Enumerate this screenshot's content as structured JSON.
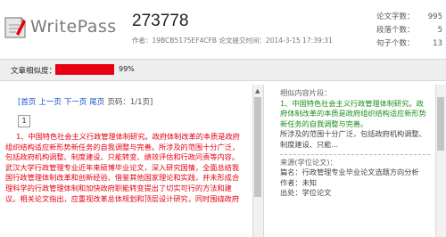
{
  "header": {
    "logo_text": "WritePass",
    "doc_id": "273778",
    "meta": "作者：19BCB5175EF4CFB  论文提交时间：2014-3-15 17:39:31"
  },
  "stats": [
    {
      "label": "论文字数：",
      "value": "995"
    },
    {
      "label": "段落个数：",
      "value": "5"
    },
    {
      "label": "句子个数：",
      "value": "13"
    }
  ],
  "similarity": {
    "label": "文章相似度：",
    "value": 0.99,
    "percent_text": "99%",
    "bar_color": "#e60012"
  },
  "nav": {
    "first": "[首页",
    "prev": "上一页",
    "next": "下一页",
    "last": "尾页",
    "page_info": "页码：1/1页]"
  },
  "page_number": "1",
  "content": "1、中国特色社会主义行政管理体制研究。政府体制改革的本质是政府组织结构适应新形势新任务的自我调整与完善。所涉及的范围十分广泛，包括政府机构调整、制度建设、只能转变、绩效评估和行政问责等内容。武汉大学行政管理专业近年来硕博毕业论文，深入研究国情，全面总结我国行政管理体制改革和创新经验、借鉴其他国家理论和实践，并未形成合理科学的行政管理体制和加快政府职能转变提出了切实可行的方法和建议。相关论文指出，应重视改革总体规划和顶层设计研究，同时围绕政府",
  "right": {
    "similar_title": "相似内容片段：",
    "similar_text": "1、中国特色社会主义行政管理体制研究。政府体制改革的本质是政府组织结构适应新形势新任务的自我调整与完善。",
    "similar_tail": "所涉及的范围十分广泛，包括政府机构调整、制度建设、只能...",
    "source_title": "来源(学位论文)：",
    "source_name_label": "篇名：",
    "source_name": "行政管理专业毕业论文选题方向分析",
    "author_label": "作者：",
    "author": "未知",
    "origin_label": "出处：",
    "origin": "学位论文"
  },
  "colors": {
    "highlight_red": "#e60012",
    "highlight_green": "#1a8f1a",
    "link_blue": "#1a52c4"
  },
  "icons": [
    "writepass-logo-icon",
    "scroll-up-arrow-icon"
  ]
}
